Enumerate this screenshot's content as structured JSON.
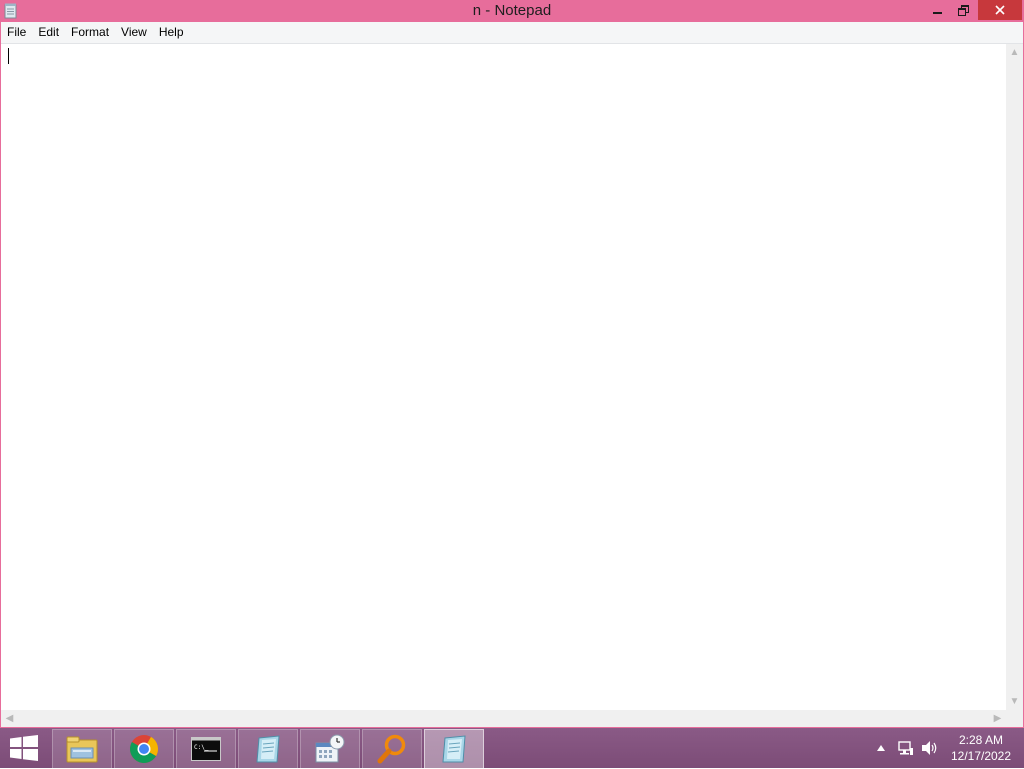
{
  "window": {
    "title": "n - Notepad"
  },
  "menu": {
    "items": [
      "File",
      "Edit",
      "Format",
      "View",
      "Help"
    ]
  },
  "editor": {
    "content": ""
  },
  "taskbar": {
    "apps": [
      {
        "name": "file-explorer-icon"
      },
      {
        "name": "chrome-icon"
      },
      {
        "name": "command-prompt-icon"
      },
      {
        "name": "notepad-icon"
      },
      {
        "name": "scheduler-icon"
      },
      {
        "name": "search-magnifier-icon"
      },
      {
        "name": "notepad-active-icon"
      }
    ],
    "clock_time": "2:28 AM",
    "clock_date": "12/17/2022"
  },
  "colors": {
    "titlebar": "#e76d9b",
    "close_button": "#c7383c",
    "taskbar": "#85567f"
  }
}
